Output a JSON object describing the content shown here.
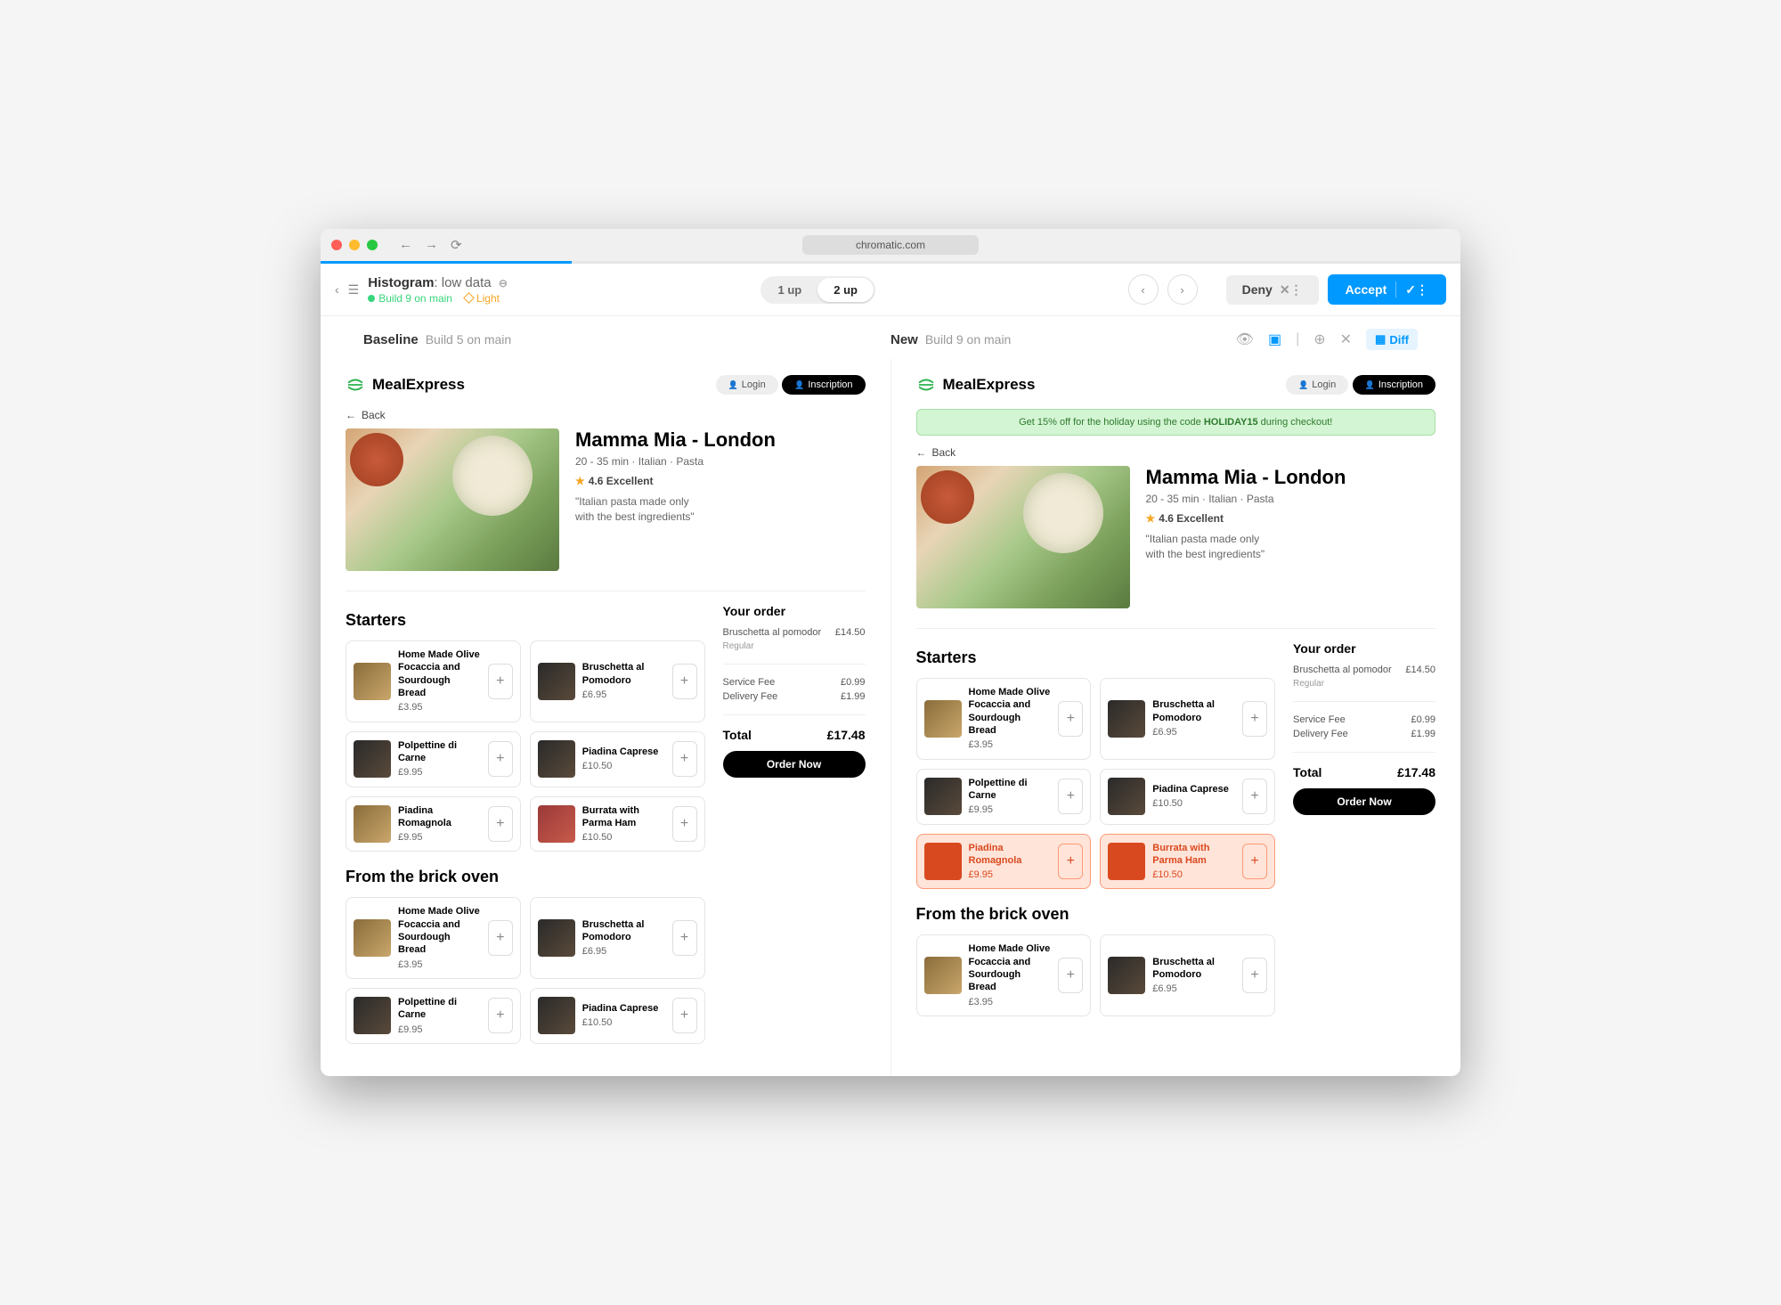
{
  "browser": {
    "domain": "chromatic.com"
  },
  "topbar": {
    "title_prefix": "Histogram",
    "title_suffix": ": low data",
    "build_label": "Build 9 on main",
    "theme": "Light",
    "view_1up": "1 up",
    "view_2up": "2 up",
    "deny": "Deny",
    "accept": "Accept"
  },
  "compare": {
    "baseline_label": "Baseline",
    "baseline_sub": "Build 5 on main",
    "new_label": "New",
    "new_sub": "Build 9 on main",
    "diff_label": "Diff"
  },
  "app": {
    "brand": "MealExpress",
    "login": "Login",
    "signup": "Inscription",
    "back": "Back",
    "restaurant": "Mamma Mia - London",
    "meta": "20 - 35 min · Italian · Pasta",
    "rating": "4.6 Excellent",
    "tagline_l1": "\"Italian pasta made only",
    "tagline_l2": "with the best ingredients\"",
    "promo_pre": "Get 15% off for the holiday using the code ",
    "promo_code": "HOLIDAY15",
    "promo_post": " during checkout!"
  },
  "sections": {
    "starters": "Starters",
    "brick_oven": "From the brick oven"
  },
  "items": {
    "focaccia": {
      "name": "Home Made Olive Focaccia and Sourdough Bread",
      "price": "£3.95"
    },
    "bruschetta": {
      "name": "Bruschetta al Pomodoro",
      "price": "£6.95"
    },
    "polpettine": {
      "name": "Polpettine di Carne",
      "price": "£9.95"
    },
    "piadina_caprese": {
      "name": "Piadina Caprese",
      "price": "£10.50"
    },
    "piadina_romagnola": {
      "name": "Piadina Romagnola",
      "price": "£9.95"
    },
    "burrata": {
      "name": "Burrata with Parma Ham",
      "price": "£10.50"
    }
  },
  "order": {
    "title": "Your order",
    "item": "Bruschetta al pomodor",
    "item_price": "£14.50",
    "variant": "Regular",
    "service_fee_label": "Service Fee",
    "service_fee": "£0.99",
    "delivery_fee_label": "Delivery Fee",
    "delivery_fee": "£1.99",
    "total_label": "Total",
    "total": "£17.48",
    "button": "Order Now"
  }
}
